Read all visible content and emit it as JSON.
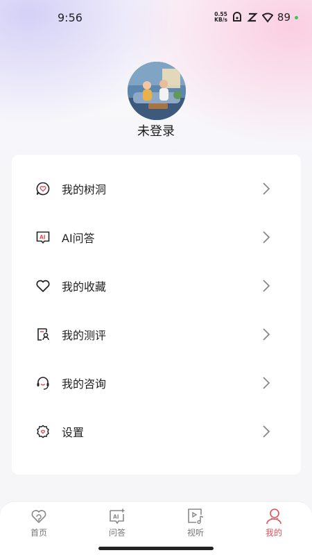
{
  "status_bar": {
    "time": "9:56",
    "net_speed_value": "0.55",
    "net_speed_unit": "KB/s",
    "battery": "89"
  },
  "profile": {
    "login_status": "未登录"
  },
  "menu": {
    "items": [
      {
        "label": "我的树洞",
        "icon": "heart-chat-icon"
      },
      {
        "label": "AI问答",
        "icon": "ai-chat-icon"
      },
      {
        "label": "我的收藏",
        "icon": "heart-icon"
      },
      {
        "label": "我的测评",
        "icon": "assessment-icon"
      },
      {
        "label": "我的咨询",
        "icon": "headset-icon"
      },
      {
        "label": "设置",
        "icon": "settings-icon"
      }
    ]
  },
  "tabbar": {
    "tabs": [
      {
        "label": "首页",
        "icon": "home-icon",
        "active": false
      },
      {
        "label": "问答",
        "icon": "ai-qa-icon",
        "active": false
      },
      {
        "label": "视听",
        "icon": "music-video-icon",
        "active": false
      },
      {
        "label": "我的",
        "icon": "profile-icon",
        "active": true
      }
    ]
  },
  "colors": {
    "accent": "#e2505a",
    "inactive_tab": "#777777",
    "card_bg": "#ffffff"
  }
}
